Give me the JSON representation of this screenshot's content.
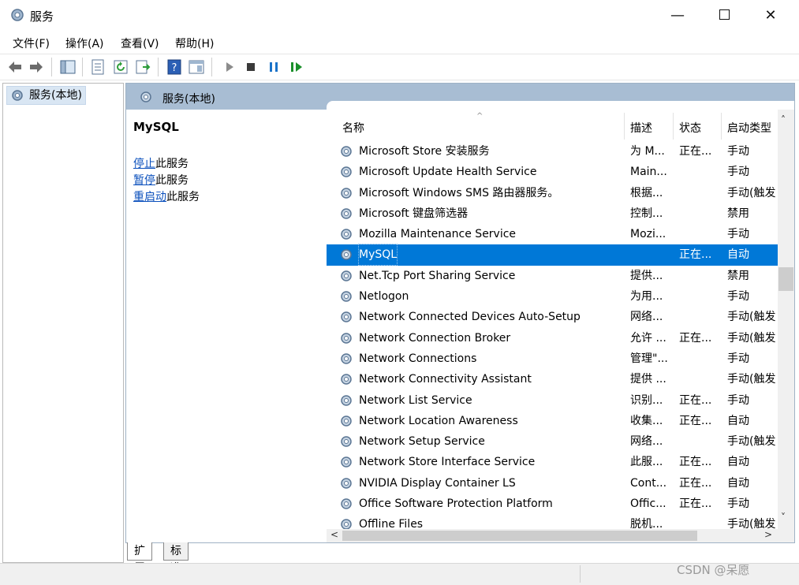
{
  "window": {
    "title": "服务",
    "controls": {
      "minimize": "—",
      "close": "✕"
    }
  },
  "menu": [
    "文件(F)",
    "操作(A)",
    "查看(V)",
    "帮助(H)"
  ],
  "tree": {
    "root_label": "服务(本地)"
  },
  "pane": {
    "header": "服务(本地)",
    "selected_service": "MySQL",
    "actions": [
      {
        "link": "停止",
        "rest": "此服务"
      },
      {
        "link": "暂停",
        "rest": "此服务"
      },
      {
        "link": "重启动",
        "rest": "此服务"
      }
    ]
  },
  "table": {
    "columns": {
      "name": "名称",
      "desc": "描述",
      "status": "状态",
      "startup": "启动类型"
    },
    "rows": [
      {
        "name": "Microsoft Store 安装服务",
        "desc": "为 M...",
        "status": "正在...",
        "startup": "手动"
      },
      {
        "name": "Microsoft Update Health Service",
        "desc": "Main...",
        "status": "",
        "startup": "手动"
      },
      {
        "name": "Microsoft Windows SMS 路由器服务。",
        "desc": "根据...",
        "status": "",
        "startup": "手动(触发"
      },
      {
        "name": "Microsoft 键盘筛选器",
        "desc": "控制...",
        "status": "",
        "startup": "禁用"
      },
      {
        "name": "Mozilla Maintenance Service",
        "desc": "Mozi...",
        "status": "",
        "startup": "手动"
      },
      {
        "name": "MySQL",
        "desc": "",
        "status": "正在...",
        "startup": "自动",
        "selected": true
      },
      {
        "name": "Net.Tcp Port Sharing Service",
        "desc": "提供...",
        "status": "",
        "startup": "禁用"
      },
      {
        "name": "Netlogon",
        "desc": "为用...",
        "status": "",
        "startup": "手动"
      },
      {
        "name": "Network Connected Devices Auto-Setup",
        "desc": "网络...",
        "status": "",
        "startup": "手动(触发"
      },
      {
        "name": "Network Connection Broker",
        "desc": "允许 ...",
        "status": "正在...",
        "startup": "手动(触发"
      },
      {
        "name": "Network Connections",
        "desc": "管理\"...",
        "status": "",
        "startup": "手动"
      },
      {
        "name": "Network Connectivity Assistant",
        "desc": "提供 ...",
        "status": "",
        "startup": "手动(触发"
      },
      {
        "name": "Network List Service",
        "desc": "识别...",
        "status": "正在...",
        "startup": "手动"
      },
      {
        "name": "Network Location Awareness",
        "desc": "收集...",
        "status": "正在...",
        "startup": "自动"
      },
      {
        "name": "Network Setup Service",
        "desc": "网络...",
        "status": "",
        "startup": "手动(触发"
      },
      {
        "name": "Network Store Interface Service",
        "desc": "此服...",
        "status": "正在...",
        "startup": "自动"
      },
      {
        "name": "NVIDIA Display Container LS",
        "desc": "Cont...",
        "status": "正在...",
        "startup": "自动"
      },
      {
        "name": "Office Software Protection Platform",
        "desc": "Offic...",
        "status": "正在...",
        "startup": "手动"
      },
      {
        "name": "Offline Files",
        "desc": "脱机...",
        "status": "",
        "startup": "手动(触发"
      }
    ]
  },
  "tabs": [
    "扩展",
    "标准"
  ],
  "watermark": "CSDN @呆愿",
  "colors": {
    "selection": "#0078d7",
    "pane_header": "#a8bdd3",
    "link": "#0a4fbc"
  }
}
